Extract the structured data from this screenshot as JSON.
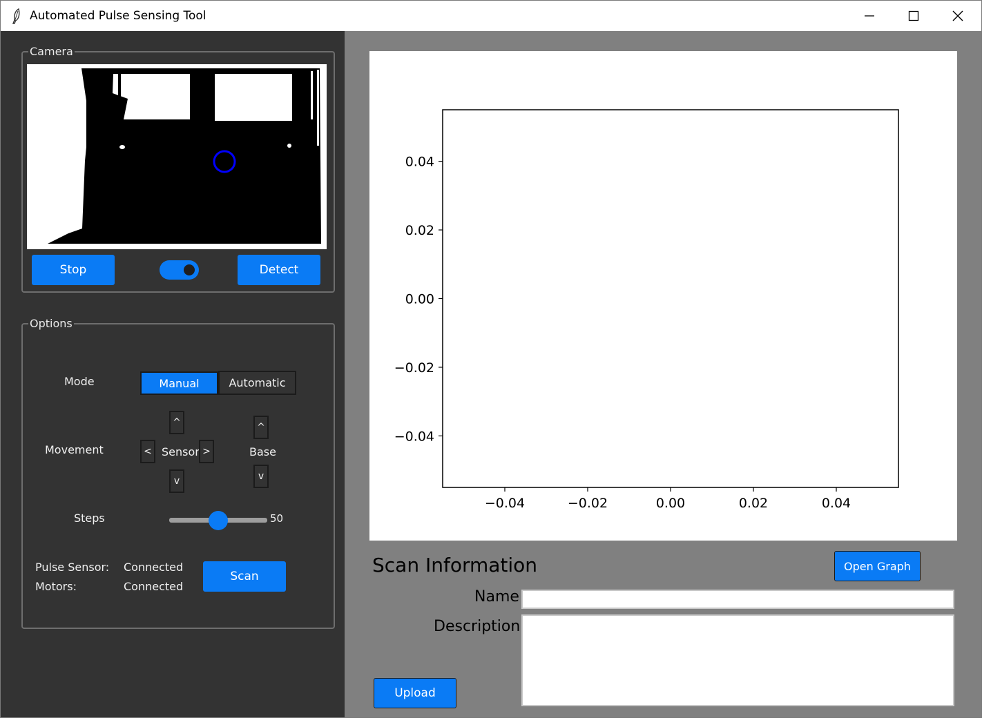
{
  "window": {
    "title": "Automated Pulse Sensing Tool"
  },
  "camera": {
    "group_label": "Camera",
    "stop_label": "Stop",
    "detect_label": "Detect",
    "toggle_on": true
  },
  "options": {
    "group_label": "Options",
    "mode_label": "Mode",
    "mode_manual": "Manual",
    "mode_automatic": "Automatic",
    "mode_selected": "Manual",
    "movement_label": "Movement",
    "sensor_label": "Sensor",
    "base_label": "Base",
    "up_symbol": "^",
    "down_symbol": "v",
    "left_symbol": "<",
    "right_symbol": ">",
    "steps_label": "Steps",
    "steps_value": "50",
    "steps_fraction": 0.5,
    "pulse_sensor_label": "Pulse Sensor:",
    "pulse_sensor_status": "Connected",
    "motors_label": "Motors:",
    "motors_status": "Connected",
    "scan_label": "Scan"
  },
  "chart_data": {
    "type": "line",
    "series": [],
    "xlim": [
      -0.055,
      0.055
    ],
    "ylim": [
      -0.055,
      0.055
    ],
    "xticks": [
      -0.04,
      -0.02,
      0.0,
      0.02,
      0.04
    ],
    "yticks": [
      -0.04,
      -0.02,
      0.0,
      0.02,
      0.04
    ],
    "xtick_labels": [
      "−0.04",
      "−0.02",
      "0.00",
      "0.02",
      "0.04"
    ],
    "ytick_labels": [
      "−0.04",
      "−0.02",
      "0.00",
      "0.02",
      "0.04"
    ],
    "title": "",
    "xlabel": "",
    "ylabel": "",
    "grid": false
  },
  "scan_info": {
    "heading": "Scan Information",
    "open_graph_label": "Open Graph",
    "name_label": "Name",
    "name_value": "",
    "description_label": "Description",
    "description_value": "",
    "upload_label": "Upload"
  },
  "colors": {
    "accent": "#0a7bf5",
    "panel_dark": "#333333",
    "panel_grey": "#808080",
    "detection_circle": "#0000ff"
  },
  "icons": {
    "app": "feather-icon",
    "minimize": "minimize-icon",
    "maximize": "maximize-icon",
    "close": "close-icon"
  }
}
